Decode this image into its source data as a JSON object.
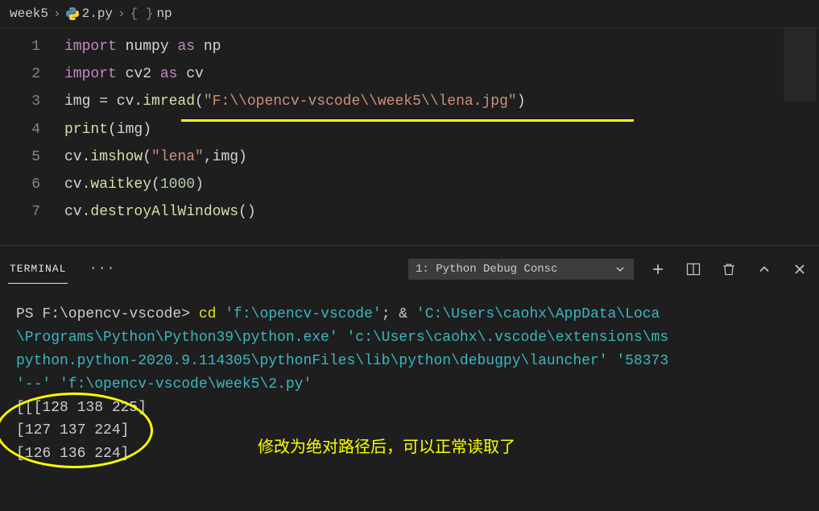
{
  "breadcrumb": {
    "part1": "week5",
    "part2": "2.py",
    "part3": "np",
    "curly": "{ }"
  },
  "code": {
    "lines": [
      {
        "n": "1",
        "tokens": [
          {
            "c": "kw",
            "t": "import"
          },
          {
            "c": "white",
            "t": " numpy "
          },
          {
            "c": "kw",
            "t": "as"
          },
          {
            "c": "white",
            "t": " np"
          }
        ]
      },
      {
        "n": "2",
        "tokens": [
          {
            "c": "kw",
            "t": "import"
          },
          {
            "c": "white",
            "t": " cv2 "
          },
          {
            "c": "kw",
            "t": "as"
          },
          {
            "c": "white",
            "t": " cv"
          }
        ]
      },
      {
        "n": "3",
        "tokens": [
          {
            "c": "white",
            "t": "img = cv."
          },
          {
            "c": "func",
            "t": "imread"
          },
          {
            "c": "white",
            "t": "("
          },
          {
            "c": "str",
            "t": "\"F:\\\\opencv-vscode\\\\week5\\\\lena.jpg\""
          },
          {
            "c": "white",
            "t": ")"
          }
        ]
      },
      {
        "n": "4",
        "tokens": [
          {
            "c": "func",
            "t": "print"
          },
          {
            "c": "white",
            "t": "(img)"
          }
        ]
      },
      {
        "n": "5",
        "tokens": [
          {
            "c": "white",
            "t": "cv."
          },
          {
            "c": "func",
            "t": "imshow"
          },
          {
            "c": "white",
            "t": "("
          },
          {
            "c": "str",
            "t": "\"lena\""
          },
          {
            "c": "white",
            "t": ",img)"
          }
        ]
      },
      {
        "n": "6",
        "tokens": [
          {
            "c": "white",
            "t": "cv."
          },
          {
            "c": "func",
            "t": "waitkey"
          },
          {
            "c": "white",
            "t": "("
          },
          {
            "c": "num",
            "t": "1000"
          },
          {
            "c": "white",
            "t": ")"
          }
        ]
      },
      {
        "n": "7",
        "tokens": [
          {
            "c": "white",
            "t": "cv."
          },
          {
            "c": "func",
            "t": "destroyAllWindows"
          },
          {
            "c": "white",
            "t": "()"
          }
        ]
      }
    ]
  },
  "panel": {
    "tab": "TERMINAL",
    "dots": "···",
    "dropdown": "1: Python Debug Consc"
  },
  "terminal": {
    "prompt": "PS F:\\opencv-vscode> ",
    "cmd_cd": "cd ",
    "path1": "'f:\\opencv-vscode'",
    "amp": "; & ",
    "path2": "'C:\\Users\\caohx\\AppData\\Loca",
    "path3": "\\Programs\\Python\\Python39\\python.exe'",
    "path4": " 'c:\\Users\\caohx\\.vscode\\extensions\\ms",
    "path5": "python.python-2020.9.114305\\pythonFiles\\lib\\python\\debugpy\\launcher'",
    "path6": " '58373",
    "path7": "'--'",
    "path8": " 'f:\\opencv-vscode\\week5\\2.py'",
    "out1": "[[[128 138 225]",
    "out2": "  [127 137 224]",
    "out3": "  [126 136 224]"
  },
  "annotation": "修改为绝对路径后，可以正常读取了"
}
